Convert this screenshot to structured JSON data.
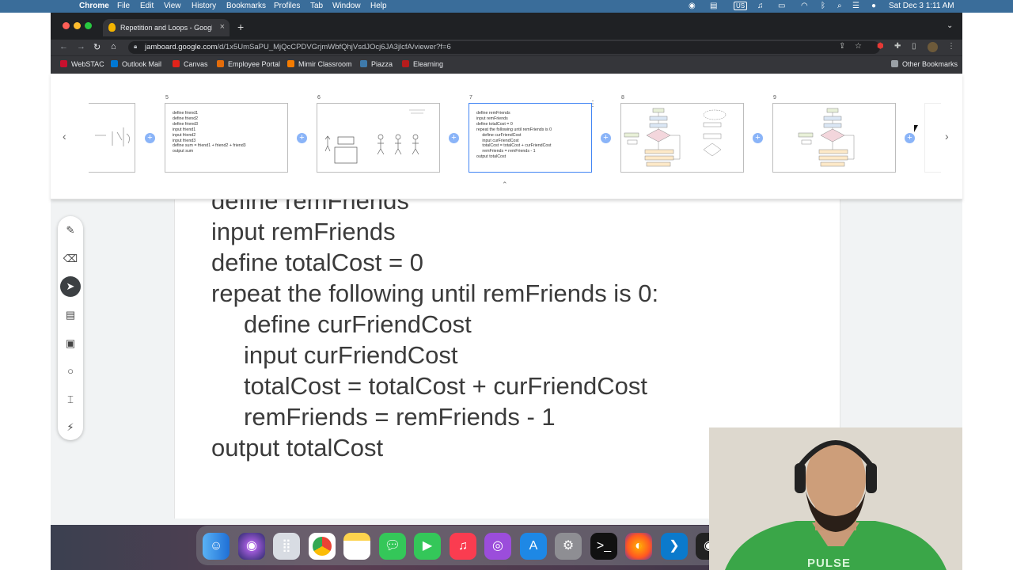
{
  "menubar": {
    "app": "Chrome",
    "items": [
      "File",
      "Edit",
      "View",
      "History",
      "Bookmarks",
      "Profiles",
      "Tab",
      "Window",
      "Help"
    ],
    "input_source": "US",
    "datetime": "Sat Dec 3  1:11 AM"
  },
  "browser": {
    "tab_title": "Repetition and Loops - Google",
    "url_host": "jamboard.google.com",
    "url_path": "/d/1x5UmSaPU_MjQcCPDVGrjmWbfQhjVsdJOcj6JA3jlcfA/viewer?f=6",
    "bookmarks": [
      {
        "label": "WebSTAC",
        "color": "#c8102e"
      },
      {
        "label": "Outlook Mail",
        "color": "#0078d4"
      },
      {
        "label": "Canvas",
        "color": "#e2231a"
      },
      {
        "label": "Employee Portal",
        "color": "#e46c0a"
      },
      {
        "label": "Mimir Classroom",
        "color": "#f57c00"
      },
      {
        "label": "Piazza",
        "color": "#3e7aab"
      },
      {
        "label": "Elearning",
        "color": "#b71c1c"
      }
    ],
    "other_bookmarks": "Other Bookmarks"
  },
  "filmstrip": {
    "frames": [
      {
        "num": "",
        "text": ""
      },
      {
        "num": "5",
        "text": "define friend1\ndefine friend2\ndefine friend3\ninput friend1\ninput friend2\ninput friend3\ndefine sum = friend1 + friend2 + friend3\noutput sum"
      },
      {
        "num": "6",
        "text": ""
      },
      {
        "num": "7",
        "text": "define remFriends\ninput remFriends\ndefine totalCost = 0\nrepeat the following until remFriends is 0\n     define curFriendCost\n     input curFriendCost\n     totalCost = totalCost + curFriendCost\n     remFriends = remFriends - 1\noutput totalCost"
      },
      {
        "num": "8",
        "text": ""
      },
      {
        "num": "9",
        "text": ""
      }
    ]
  },
  "canvas": {
    "lines": [
      {
        "text": "define remFriends",
        "indent": false
      },
      {
        "text": "input remFriends",
        "indent": false
      },
      {
        "text": "define totalCost = 0",
        "indent": false
      },
      {
        "text": "repeat the following until remFriends is 0:",
        "indent": false
      },
      {
        "text": "define curFriendCost",
        "indent": true
      },
      {
        "text": "input curFriendCost",
        "indent": true
      },
      {
        "text": "totalCost = totalCost + curFriendCost",
        "indent": true
      },
      {
        "text": "remFriends = remFriends - 1",
        "indent": true
      },
      {
        "text": "output totalCost",
        "indent": false
      }
    ]
  },
  "tools": [
    "pen-icon",
    "eraser-icon",
    "select-icon",
    "sticky-note-icon",
    "image-icon",
    "shape-icon",
    "textbox-icon",
    "laser-icon"
  ],
  "webcam": {
    "shirt_text": "PULSE"
  }
}
